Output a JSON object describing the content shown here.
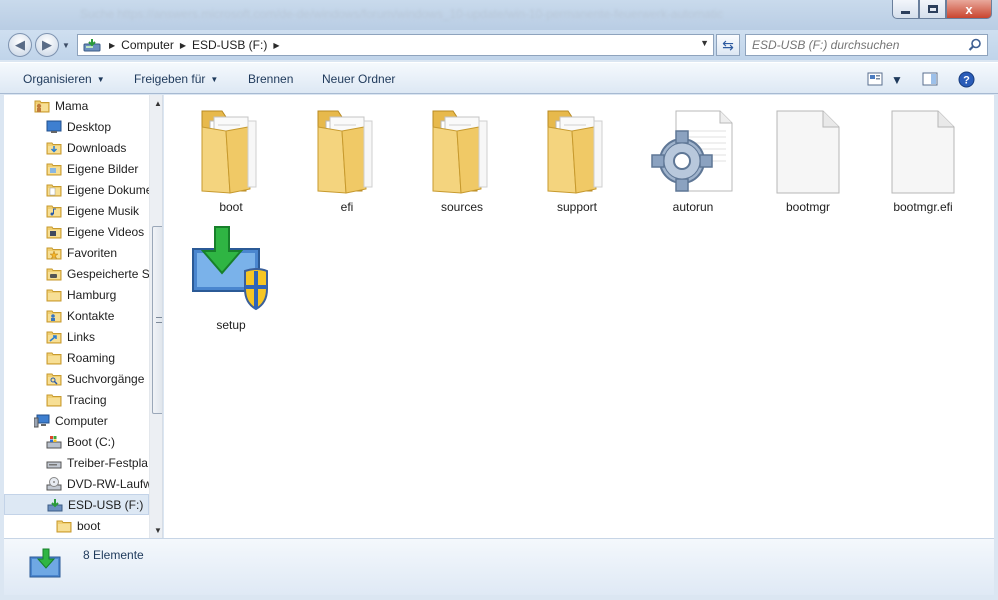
{
  "titlebar": {
    "blurred_text": "Suche    https://answers.microsoft.com/de-de/windows/forum/windows_10-update/win-10-permanente-feuerwerk-automatic"
  },
  "window_controls": {
    "close_label": "x"
  },
  "address": {
    "root": "Computer",
    "drive": "ESD-USB (F:)",
    "separator": "▶"
  },
  "search": {
    "placeholder": "ESD-USB (F:) durchsuchen"
  },
  "toolbar": {
    "organize": "Organisieren",
    "share": "Freigeben für",
    "burn": "Brennen",
    "new_folder": "Neuer Ordner",
    "dropdown_arrow": "▼",
    "help": "?"
  },
  "nav": {
    "items": [
      {
        "label": "Mama",
        "icon": "user-folder-icon",
        "level": 1
      },
      {
        "label": "Desktop",
        "icon": "desktop-icon",
        "level": 2
      },
      {
        "label": "Downloads",
        "icon": "downloads-icon",
        "level": 2
      },
      {
        "label": "Eigene Bilder",
        "icon": "pictures-folder-icon",
        "level": 2
      },
      {
        "label": "Eigene Dokume",
        "icon": "documents-folder-icon",
        "level": 2
      },
      {
        "label": "Eigene Musik",
        "icon": "music-folder-icon",
        "level": 2
      },
      {
        "label": "Eigene Videos",
        "icon": "videos-folder-icon",
        "level": 2
      },
      {
        "label": "Favoriten",
        "icon": "favorites-folder-icon",
        "level": 2
      },
      {
        "label": "Gespeicherte Sp",
        "icon": "saved-games-icon",
        "level": 2
      },
      {
        "label": "Hamburg",
        "icon": "folder-icon",
        "level": 2
      },
      {
        "label": "Kontakte",
        "icon": "contacts-folder-icon",
        "level": 2
      },
      {
        "label": "Links",
        "icon": "links-folder-icon",
        "level": 2
      },
      {
        "label": "Roaming",
        "icon": "folder-icon",
        "level": 2
      },
      {
        "label": "Suchvorgänge",
        "icon": "searches-folder-icon",
        "level": 2
      },
      {
        "label": "Tracing",
        "icon": "folder-icon",
        "level": 2
      },
      {
        "label": "Computer",
        "icon": "computer-icon",
        "level": 1
      },
      {
        "label": "Boot (C:)",
        "icon": "system-drive-icon",
        "level": 2
      },
      {
        "label": "Treiber-Festpla",
        "icon": "hard-drive-icon",
        "level": 2
      },
      {
        "label": "DVD-RW-Laufw",
        "icon": "dvd-drive-icon",
        "level": 2
      },
      {
        "label": "ESD-USB (F:)",
        "icon": "usb-drive-icon",
        "level": 2,
        "selected": true
      },
      {
        "label": "boot",
        "icon": "folder-icon",
        "level": 3
      }
    ]
  },
  "files": [
    {
      "name": "boot",
      "type": "folder"
    },
    {
      "name": "efi",
      "type": "folder"
    },
    {
      "name": "sources",
      "type": "folder"
    },
    {
      "name": "support",
      "type": "folder"
    },
    {
      "name": "autorun",
      "type": "settings-file"
    },
    {
      "name": "bootmgr",
      "type": "blank-file"
    },
    {
      "name": "bootmgr.efi",
      "type": "blank-file"
    },
    {
      "name": "setup",
      "type": "setup-exe"
    }
  ],
  "status": {
    "count_text": "8 Elemente"
  },
  "colors": {
    "folder_yellow": "#f2d27a",
    "accent_blue": "#1e395b",
    "selection": "#dde8f4"
  }
}
